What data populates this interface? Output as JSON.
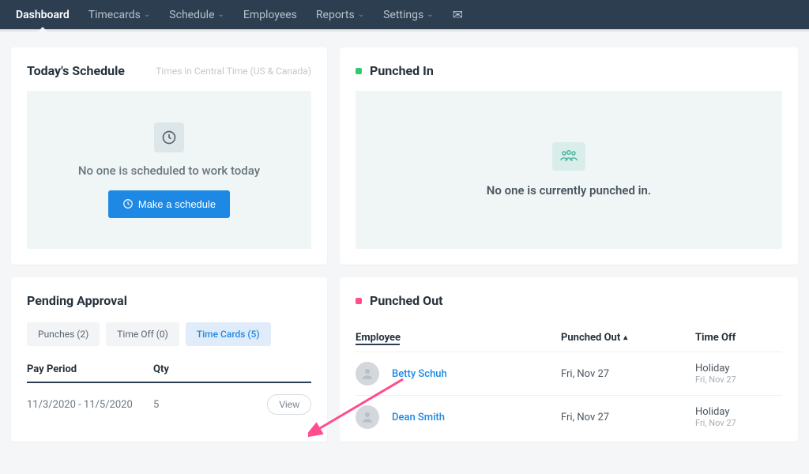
{
  "nav": {
    "items": [
      {
        "label": "Dashboard",
        "has_dropdown": false,
        "active": true
      },
      {
        "label": "Timecards",
        "has_dropdown": true,
        "active": false
      },
      {
        "label": "Schedule",
        "has_dropdown": true,
        "active": false
      },
      {
        "label": "Employees",
        "has_dropdown": false,
        "active": false
      },
      {
        "label": "Reports",
        "has_dropdown": true,
        "active": false
      },
      {
        "label": "Settings",
        "has_dropdown": true,
        "active": false
      }
    ]
  },
  "schedule": {
    "title": "Today's Schedule",
    "timezone_note": "Times in Central Time (US & Canada)",
    "empty_msg": "No one is scheduled to work today",
    "button": "Make a schedule"
  },
  "punched_in": {
    "title": "Punched In",
    "empty_msg": "No one is currently punched in."
  },
  "pending": {
    "title": "Pending Approval",
    "tabs": [
      {
        "label": "Punches (2)",
        "active": false
      },
      {
        "label": "Time Off (0)",
        "active": false
      },
      {
        "label": "Time Cards (5)",
        "active": true
      }
    ],
    "headers": {
      "period": "Pay Period",
      "qty": "Qty"
    },
    "rows": [
      {
        "period": "11/3/2020 - 11/5/2020",
        "qty": "5",
        "action": "View"
      }
    ]
  },
  "punched_out": {
    "title": "Punched Out",
    "headers": {
      "employee": "Employee",
      "punched": "Punched Out",
      "timeoff": "Time Off"
    },
    "rows": [
      {
        "name": "Betty Schuh",
        "time": "Fri, Nov 27",
        "off": "Holiday",
        "off_sub": "Fri, Nov 27"
      },
      {
        "name": "Dean Smith",
        "time": "Fri, Nov 27",
        "off": "Holiday",
        "off_sub": "Fri, Nov 27"
      }
    ]
  }
}
